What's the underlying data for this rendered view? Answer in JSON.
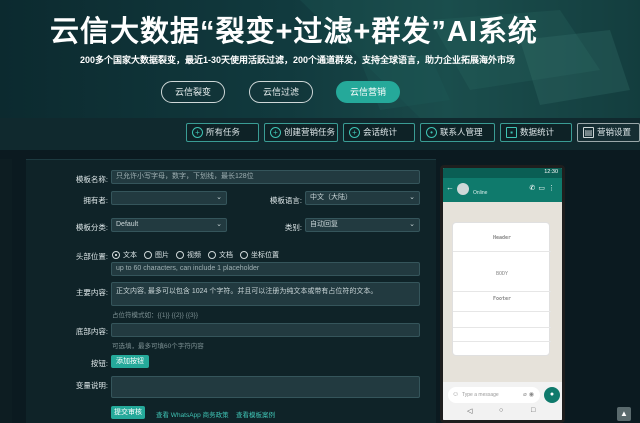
{
  "hero": {
    "title": "云信大数据“裂变+过滤+群发”AI系统",
    "subtitle": "200多个国家大数据裂变，最近1-30天使用活跃过滤，200个通道群发，支持全球语言，助力企业拓展海外市场",
    "buttons": [
      {
        "label": "云信裂变",
        "active": false
      },
      {
        "label": "云信过滤",
        "active": false
      },
      {
        "label": "云信营销",
        "active": true
      }
    ]
  },
  "nav": {
    "items": [
      {
        "label": "所有任务",
        "icon": "plus-circle-icon"
      },
      {
        "label": "创建营销任务",
        "icon": "plus-circle-icon"
      },
      {
        "label": "会话统计",
        "icon": "plus-circle-icon"
      },
      {
        "label": "联系人管理",
        "icon": "user-icon"
      },
      {
        "label": "数据统计",
        "icon": "chart-icon"
      },
      {
        "label": "营销设置",
        "icon": "settings-icon"
      }
    ]
  },
  "form": {
    "template_name": {
      "label": "模板名称:",
      "placeholder": "只允许小写字母，数字，下划线，最长128位"
    },
    "owner": {
      "label": "拥有者:",
      "value": ""
    },
    "template_lang": {
      "label": "模板语言:",
      "value": "中文（大陆）"
    },
    "category": {
      "label": "模板分类:",
      "value": "Default"
    },
    "type": {
      "label": "类别:",
      "value": "自动回复"
    },
    "header": {
      "label": "头部位置:",
      "options": [
        "文本",
        "图片",
        "视频",
        "文档",
        "坐标位置"
      ],
      "selected": 0,
      "placeholder": "up to 60 characters, can include 1 placeholder"
    },
    "body": {
      "label": "主要内容:",
      "placeholder": "正文内容, 最多可以包含 1024 个字符。并且可以注册为纯文本或带有占位符的文本。",
      "hint": "占位符模式如：{{1}} {{2}} {{3}}"
    },
    "footer": {
      "label": "底部内容:",
      "hint": "可选填，最多可填60个字符内容"
    },
    "buttons": {
      "label": "按钮:",
      "add_label": "添加按钮"
    },
    "variables": {
      "label": "变量说明:"
    },
    "submit_label": "提交审核",
    "link_policy": "查看 WhatsApp 商务政策",
    "link_example": "查看模板案例"
  },
  "phone": {
    "time": "12:30",
    "status": "Online",
    "card": {
      "header": "Header",
      "body": "BODY",
      "footer": "Footer"
    },
    "input_placeholder": "Type a message"
  },
  "colors": {
    "accent": "#25a99a",
    "background": "#0b1a20",
    "whatsapp_green": "#0f7a6c"
  }
}
